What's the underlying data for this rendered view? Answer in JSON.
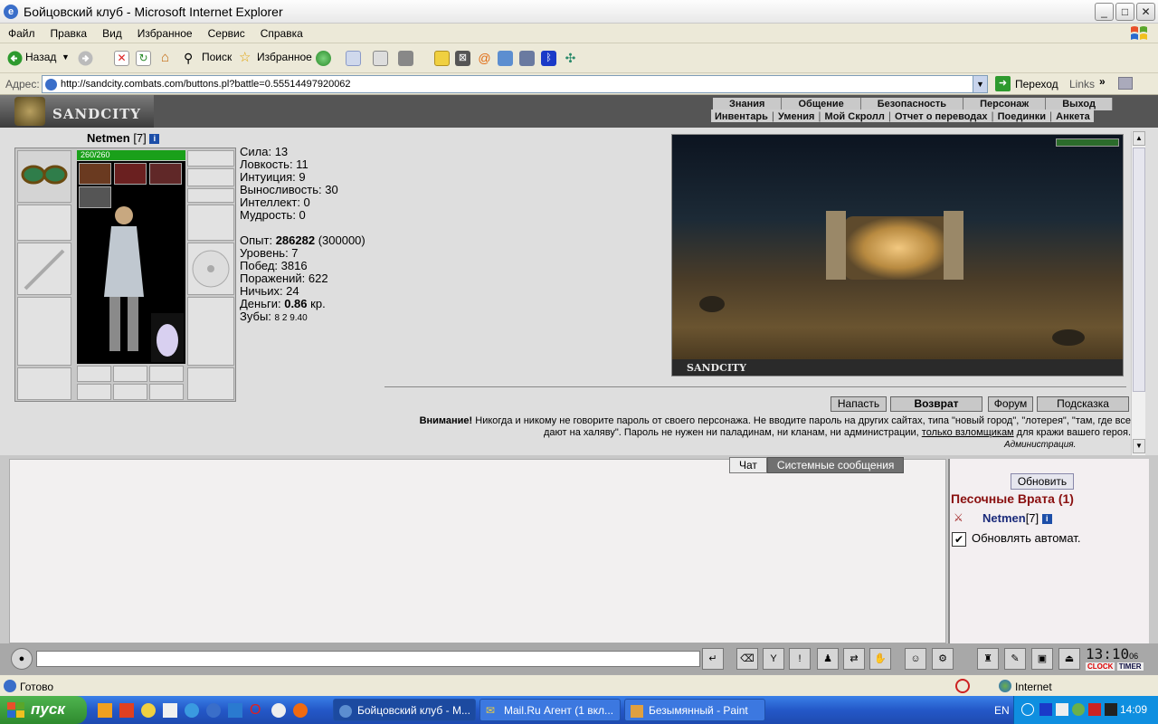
{
  "window": {
    "title": "Бойцовский клуб - Microsoft Internet Explorer",
    "min": "_",
    "max": "□",
    "close": "✕"
  },
  "menu": [
    "Файл",
    "Правка",
    "Вид",
    "Избранное",
    "Сервис",
    "Справка"
  ],
  "toolbar": {
    "back": "Назад",
    "search": "Поиск",
    "favorites": "Избранное"
  },
  "address": {
    "label": "Адрес:",
    "url": "http://sandcity.combats.com/buttons.pl?battle=0.55514497920062",
    "go": "Переход",
    "links": "Links"
  },
  "game": {
    "logo": "SANDCITY",
    "nav_main": [
      "Знания",
      "Общение",
      "Безопасность",
      "Персонаж",
      "Выход"
    ],
    "nav_sub": [
      "Инвентарь",
      "Умения",
      "Мой Скролл",
      "Отчет о переводах",
      "Поединки",
      "Анкета"
    ],
    "character": {
      "name": "Netmen",
      "level": "[7]",
      "hp": "260/260"
    },
    "stats": {
      "strength": "Сила: 13",
      "agility": "Ловкость: 11",
      "intuition": "Интуиция: 9",
      "endurance": "Выносливость: 30",
      "intellect": "Интеллект: 0",
      "wisdom": "Мудрость: 0",
      "exp_label": "Опыт: ",
      "exp_value": "286282",
      "exp_next": "(300000)",
      "level": "Уровень: 7",
      "wins": "Побед: 3816",
      "losses": "Поражений: 622",
      "draws": "Ничьих: 24",
      "money_label": "Деньги: ",
      "money_value": "0.86",
      "money_unit": "кр.",
      "teeth": "Зубы: ",
      "teeth_values": "8  2  9.40"
    },
    "scene_title": "SANDCITY",
    "actions": [
      "Напасть",
      "Возврат",
      "Форум",
      "Подсказка"
    ],
    "warning_bold": "Внимание!",
    "warning_text": " Никогда и никому не говорите пароль от своего персонажа. Не вводите пароль на других сайтах, типа \"новый город\", \"лотерея\", \"там, где все дают на халяву\". Пароль не нужен ни паладинам, ни кланам, ни администрации, ",
    "warning_link": "только взломщикам",
    "warning_tail": " для кражи вашего героя.",
    "admin_sig": "Администрация.",
    "chat_tabs": [
      "Чат",
      "Системные сообщения"
    ],
    "right": {
      "refresh": "Обновить",
      "location": "Песочные Врата (1)",
      "player_name": "Netmen",
      "player_level": "[7]",
      "auto_refresh": "Обновлять автомат.",
      "checkmark": "✔"
    },
    "clock": {
      "time": "13:10",
      "sec": "06",
      "clock_label": "CLOCK",
      "timer_label": "TIMER"
    }
  },
  "status": {
    "text": "Готово",
    "zone": "Internet"
  },
  "taskbar": {
    "start": "пуск",
    "tasks": [
      "Бойцовский клуб - M...",
      "Mail.Ru Агент (1 вкл...",
      "Безымянный - Paint"
    ],
    "lang": "EN",
    "time": "14:09"
  },
  "colors": {
    "accent_red": "#8a1010",
    "player_blue": "#1a2a7a",
    "hp_green": "#1aa01a",
    "taskbar_blue": "#2458c8",
    "start_green": "#2e8a2e"
  }
}
